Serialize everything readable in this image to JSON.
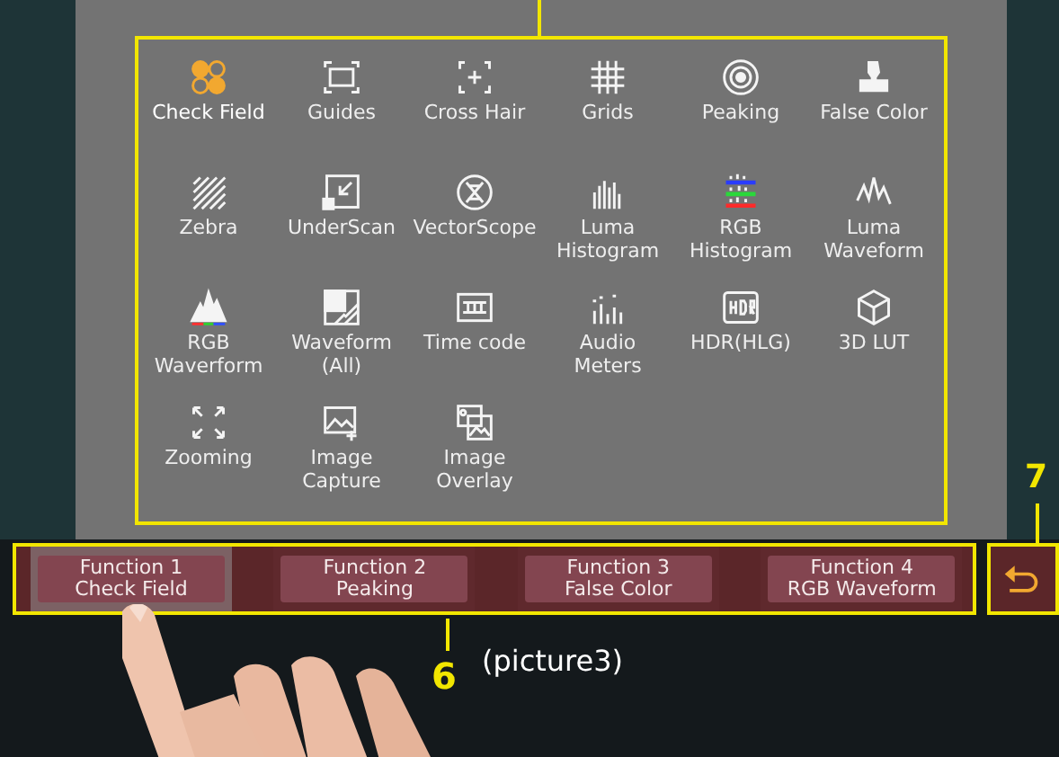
{
  "menu_items": [
    {
      "label": "Check Field",
      "selected": true
    },
    {
      "label": "Guides",
      "selected": false
    },
    {
      "label": "Cross Hair",
      "selected": false
    },
    {
      "label": "Grids",
      "selected": false
    },
    {
      "label": "Peaking",
      "selected": false
    },
    {
      "label": "False Color",
      "selected": false
    },
    {
      "label": "Zebra",
      "selected": false
    },
    {
      "label": "UnderScan",
      "selected": false
    },
    {
      "label": "VectorScope",
      "selected": false
    },
    {
      "label": "Luma Histogram",
      "selected": false
    },
    {
      "label": "RGB Histogram",
      "selected": false
    },
    {
      "label": "Luma Waveform",
      "selected": false
    },
    {
      "label": "RGB Waverform",
      "selected": false
    },
    {
      "label": "Waveform (All)",
      "selected": false
    },
    {
      "label": "Time code",
      "selected": false
    },
    {
      "label": "Audio Meters",
      "selected": false
    },
    {
      "label": "HDR(HLG)",
      "selected": false
    },
    {
      "label": "3D LUT",
      "selected": false
    },
    {
      "label": "Zooming",
      "selected": false
    },
    {
      "label": "Image Capture",
      "selected": false
    },
    {
      "label": "Image Overlay",
      "selected": false
    }
  ],
  "function_bar": [
    {
      "title": "Function 1",
      "value": "Check Field",
      "selected": true
    },
    {
      "title": "Function 2",
      "value": "Peaking",
      "selected": false
    },
    {
      "title": "Function 3",
      "value": "False Color",
      "selected": false
    },
    {
      "title": "Function 4",
      "value": "RGB Waveform",
      "selected": false
    }
  ],
  "callouts": {
    "bar_number": "6",
    "bar_caption": "(picture3)",
    "return_number": "7"
  }
}
